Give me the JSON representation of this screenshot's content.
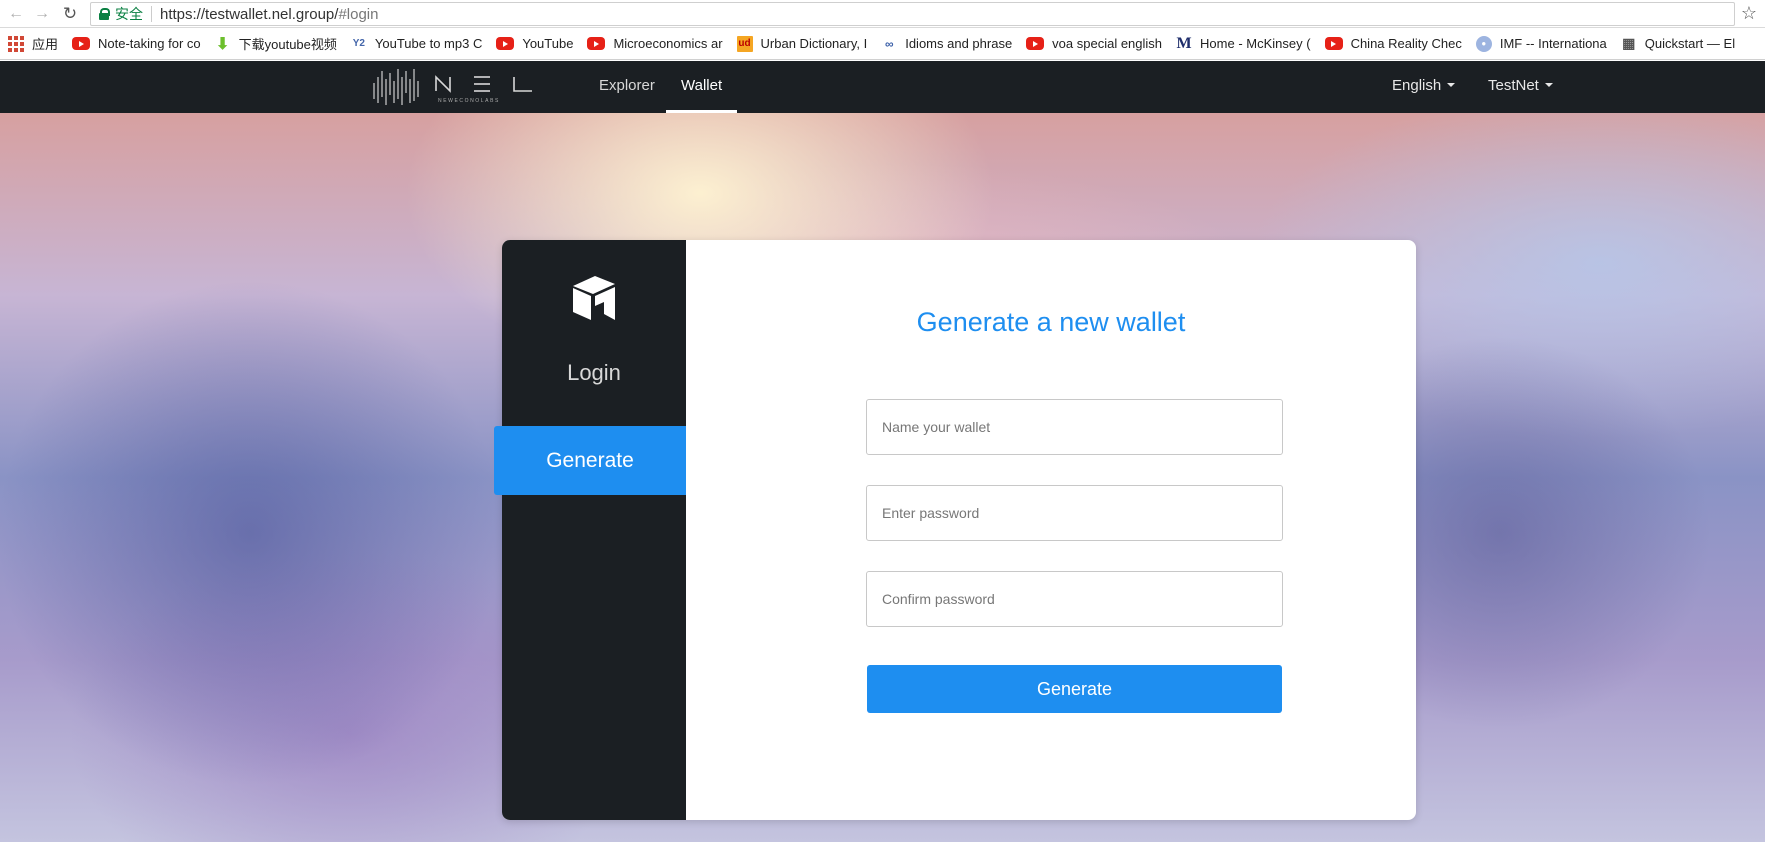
{
  "browser": {
    "secure_label": "安全",
    "url_host": "https://testwallet.nel.group/",
    "url_path": "#login",
    "bookmarks": [
      {
        "label": "应用",
        "icon": "apps-grid-icon"
      },
      {
        "label": "Note-taking for co",
        "icon": "youtube-icon"
      },
      {
        "label": "下载youtube视频",
        "icon": "download-arrow-icon"
      },
      {
        "label": "YouTube to mp3 C",
        "icon": "y2mp3-icon"
      },
      {
        "label": "YouTube",
        "icon": "youtube-icon"
      },
      {
        "label": "Microeconomics ar",
        "icon": "youtube-icon"
      },
      {
        "label": "Urban Dictionary, I",
        "icon": "urban-dictionary-icon"
      },
      {
        "label": "Idioms and phrase",
        "icon": "idioms-icon"
      },
      {
        "label": "voa special english",
        "icon": "youtube-icon"
      },
      {
        "label": "Home - McKinsey (",
        "icon": "mckinsey-icon"
      },
      {
        "label": "China Reality Chec",
        "icon": "youtube-icon"
      },
      {
        "label": "IMF -- Internationa",
        "icon": "imf-icon"
      },
      {
        "label": "Quickstart — El",
        "icon": "quickstart-icon"
      }
    ]
  },
  "header": {
    "logo_text": "NEL",
    "logo_subtext": "NEWECONOLABS",
    "nav": [
      {
        "label": "Explorer"
      },
      {
        "label": "Wallet"
      }
    ],
    "language": "English",
    "network": "TestNet"
  },
  "sidebar": {
    "items": [
      {
        "label": "Login"
      },
      {
        "label": "Generate"
      }
    ]
  },
  "form": {
    "title": "Generate a new wallet",
    "wallet_name_placeholder": "Name your wallet",
    "password_placeholder": "Enter password",
    "confirm_placeholder": "Confirm password",
    "submit_label": "Generate"
  },
  "colors": {
    "accent": "#1e8ef0",
    "dark": "#1b1f23"
  }
}
